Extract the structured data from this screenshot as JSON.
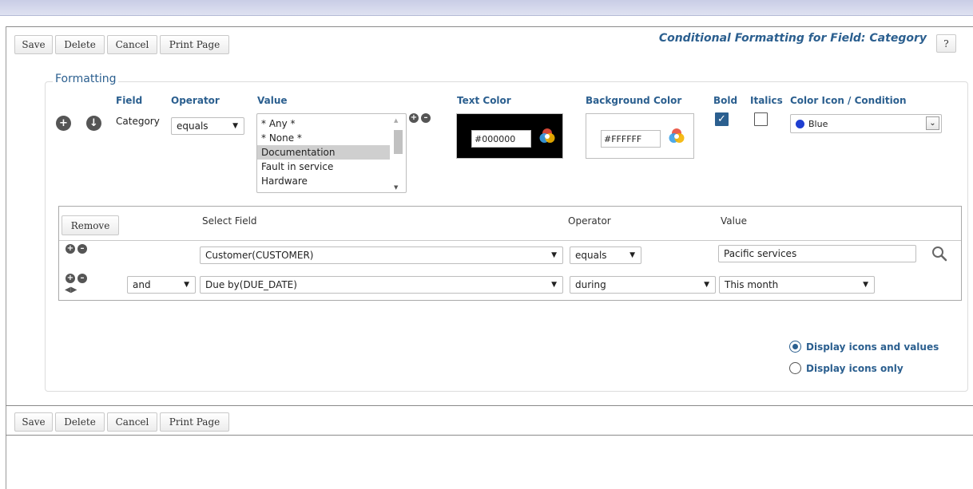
{
  "toolbar": {
    "save": "Save",
    "delete": "Delete",
    "cancel": "Cancel",
    "print": "Print Page"
  },
  "page_title": "Conditional Formatting for Field: Category",
  "help_label": "?",
  "formatting": {
    "legend": "Formatting",
    "headers": {
      "field": "Field",
      "operator": "Operator",
      "value": "Value",
      "text_color": "Text Color",
      "background_color": "Background Color",
      "bold": "Bold",
      "italics": "Italics",
      "color_icon": "Color Icon / Condition"
    },
    "field_value": "Category",
    "operator_value": "equals",
    "value_options": [
      "* Any *",
      "* None *",
      "Documentation",
      "Fault in service",
      "Hardware"
    ],
    "selected_value": "Documentation",
    "text_color": "#000000",
    "background_color": "#FFFFFF",
    "bold": true,
    "italics": false,
    "color_icon": "Blue",
    "color_icon_swatch": "#1f3fd1"
  },
  "conditions": {
    "remove_label": "Remove",
    "headers": {
      "select_field": "Select Field",
      "operator": "Operator",
      "value": "Value"
    },
    "rows": [
      {
        "conjunction": "",
        "field": "Customer(CUSTOMER)",
        "operator": "equals",
        "value": "Pacific services"
      },
      {
        "conjunction": "and",
        "field": "Due by(DUE_DATE)",
        "operator": "during",
        "value": "This month"
      }
    ]
  },
  "display_options": {
    "icons_and_values": "Display icons and values",
    "icons_only": "Display icons only",
    "selected": "icons_and_values"
  }
}
